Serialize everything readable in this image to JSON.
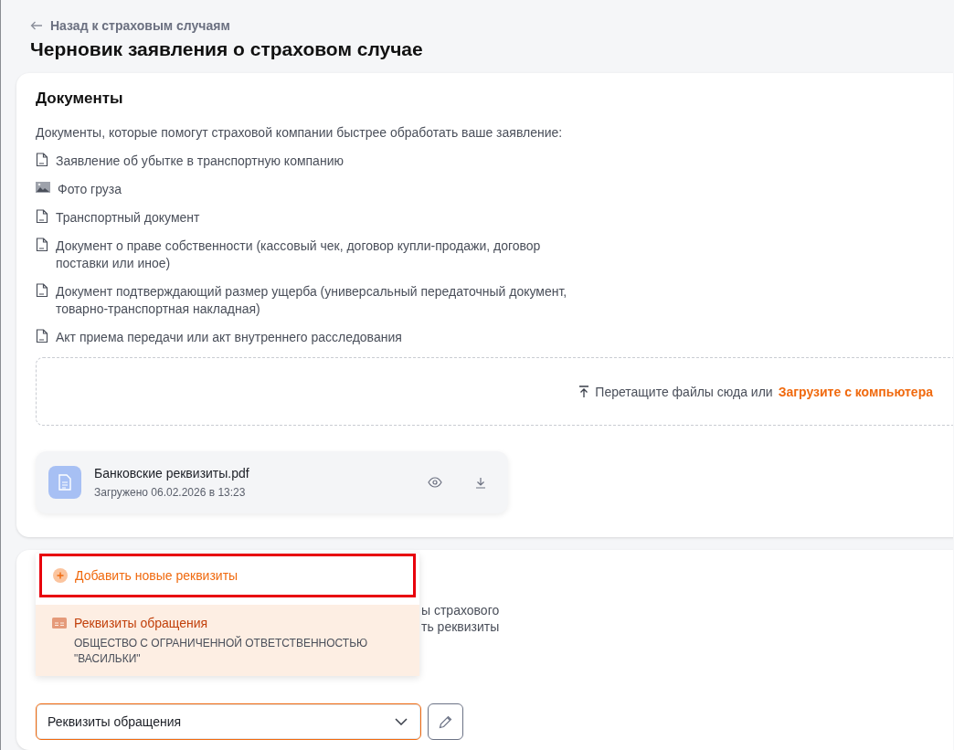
{
  "back_link": {
    "label": "Назад к страховым случаям"
  },
  "title": "Черновик заявления о страховом случае",
  "documents": {
    "heading": "Документы",
    "intro": "Документы, которые помогут страховой компании быстрее обработать ваше заявление:",
    "items": [
      {
        "kind": "file",
        "label": "Заявление об убытке в транспортную компанию"
      },
      {
        "kind": "image",
        "label": "Фото груза"
      },
      {
        "kind": "file",
        "label": "Транспортный документ"
      },
      {
        "kind": "file",
        "label": "Документ о праве собственности (кассовый чек, договор купли-продажи, договор поставки или иное)"
      },
      {
        "kind": "file",
        "label": "Документ подтверждающий размер ущерба (универсальный передаточный документ, товарно-транспортная накладная)"
      },
      {
        "kind": "file",
        "label": "Акт приема передачи или акт внутреннего расследования"
      }
    ],
    "dropzone": {
      "prompt": "Перетащите файлы сюда или",
      "link": "Загрузите с компьютера"
    },
    "uploaded_files": [
      {
        "name": "Банковские реквизиты.pdf",
        "uploaded": "Загружено 06.02.2026 в 13:23"
      }
    ]
  },
  "requisites": {
    "hidden_text": [
      "ы страхового",
      "ть реквизиты"
    ],
    "dropdown": {
      "add_option": {
        "label": "Добавить новые реквизиты",
        "highlighted": true
      },
      "options": [
        {
          "title": "Реквизиты обращения",
          "subtitle": "ОБЩЕСТВО С ОГРАНИЧЕННОЙ ОТВЕТСТВЕННОСТЬЮ \"ВАСИЛЬКИ\"",
          "selected": true
        }
      ]
    },
    "select": {
      "value": "Реквизиты обращения",
      "expanded": true
    }
  }
}
